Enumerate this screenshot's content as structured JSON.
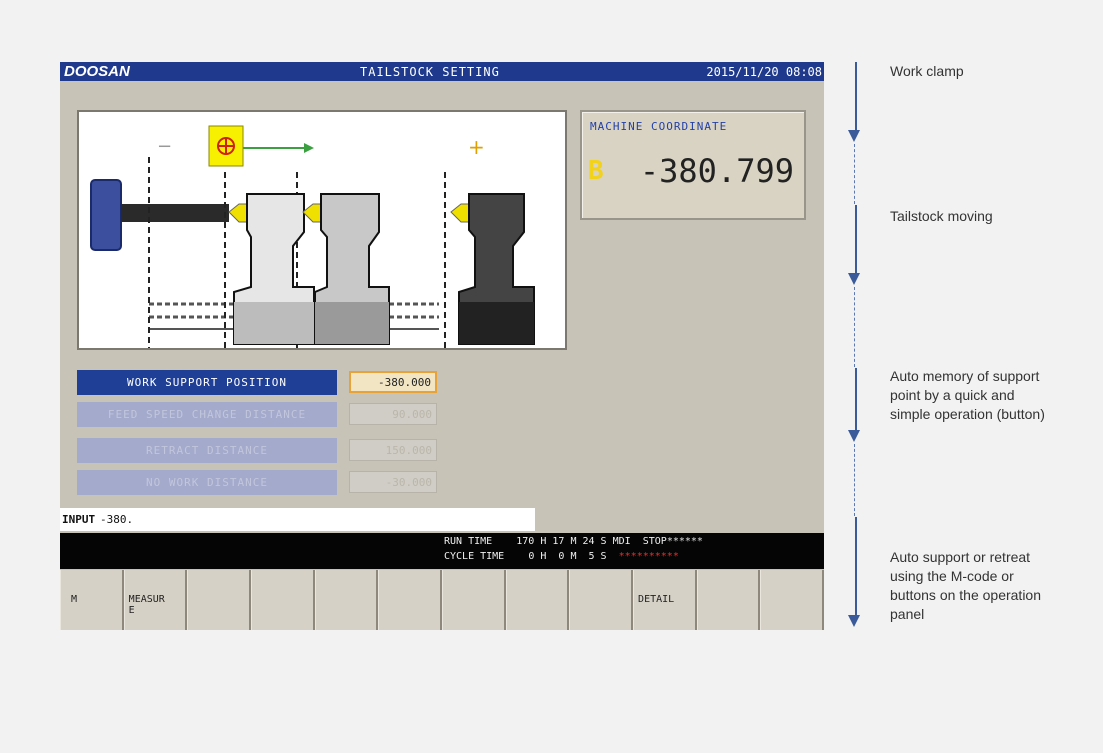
{
  "header": {
    "brand": "DOOSAN",
    "title": "TAILSTOCK SETTING",
    "datetime": "2015/11/20 08:08"
  },
  "diagram": {
    "minus_label": "−",
    "plus_label": "+"
  },
  "coordinate": {
    "title": "MACHINE COORDINATE",
    "axis": "B",
    "value": "-380.799"
  },
  "params": [
    {
      "label": "WORK SUPPORT POSITION",
      "value": "-380.000",
      "active": true
    },
    {
      "label": "FEED SPEED CHANGE DISTANCE",
      "value": "90.000",
      "active": false
    },
    {
      "label": "RETRACT DISTANCE",
      "value": "150.000",
      "active": false
    },
    {
      "label": "NO WORK DISTANCE",
      "value": "-30.000",
      "active": false
    }
  ],
  "input": {
    "label": "INPUT",
    "value": "-380."
  },
  "status": {
    "run_time_label": "RUN TIME",
    "run_time": "170 H 17 M 24 S",
    "mode": "MDI",
    "state": "STOP",
    "cycle_time_label": "CYCLE TIME",
    "cycle_time": "0 H  0 M  5 S"
  },
  "softkeys": [
    "M",
    "MEASUR\nE",
    "",
    "",
    "",
    "",
    "",
    "",
    "",
    "DETAIL",
    "",
    ""
  ],
  "annotations": [
    "Work clamp",
    "Tailstock moving",
    "Auto memory of support point by a quick and simple operation (button)",
    "Auto support or retreat using the M-code or buttons on the operation panel"
  ],
  "colors": {
    "title_bar": "#1f3a8c",
    "active_param": "#1f3f97",
    "arrow": "#3b5a9a",
    "axis_letter": "#f2d21b"
  }
}
